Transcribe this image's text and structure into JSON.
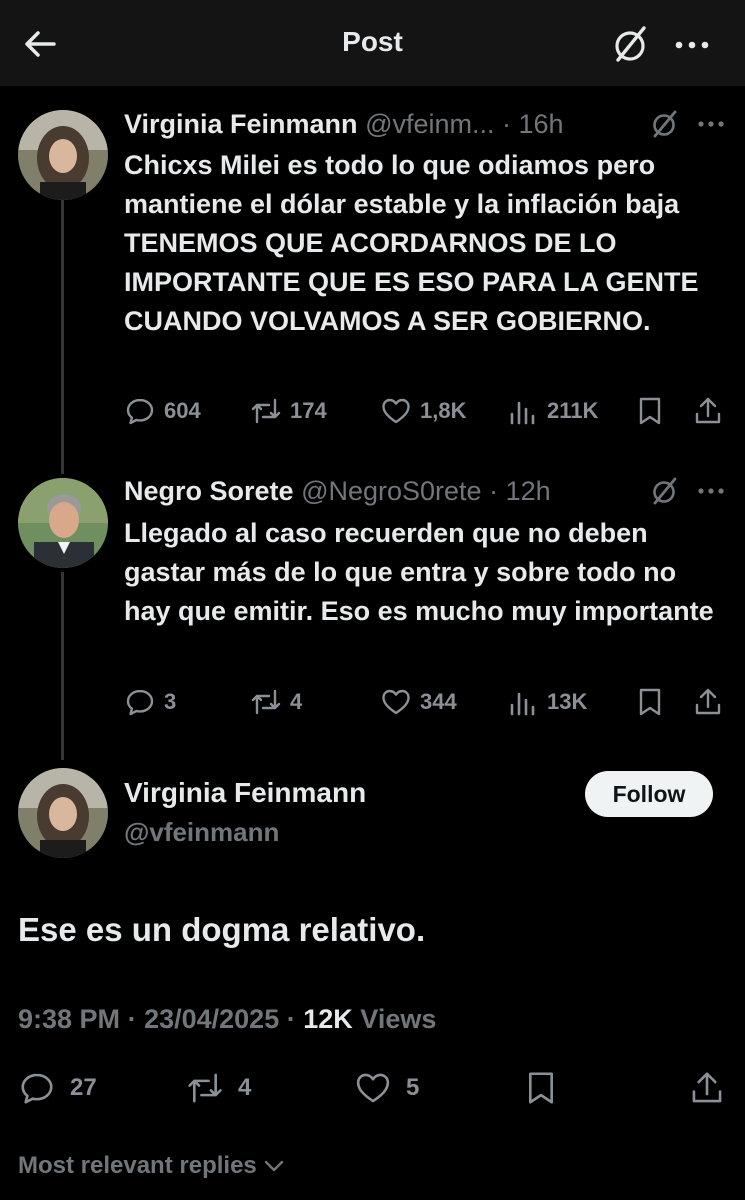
{
  "header": {
    "title": "Post",
    "back_icon": "arrow-left-icon",
    "grok_icon": "grok-icon",
    "more_icon": "more-horizontal-icon"
  },
  "thread": [
    {
      "name": "Virginia Feinmann",
      "handle": "@vfeinm...",
      "time": "16h",
      "text": "Chicxs Milei es todo lo que odiamos pero mantiene el dólar estable y la inflación baja TENEMOS QUE ACORDARNOS DE LO IMPORTANTE QUE ES ESO PARA LA GENTE CUANDO VOLVAMOS A SER GOBIERNO.",
      "replies": "604",
      "reposts": "174",
      "likes": "1,8K",
      "views": "211K"
    },
    {
      "name": "Negro Sorete",
      "handle": "@NegroS0rete",
      "time": "12h",
      "text": "Llegado al caso recuerden que no deben gastar más de lo que entra y sobre todo no hay que emitir. Eso es mucho muy importante",
      "replies": "3",
      "reposts": "4",
      "likes": "344",
      "views": "13K"
    }
  ],
  "main_post": {
    "name": "Virginia Feinmann",
    "handle": "@vfeinmann",
    "follow_label": "Follow",
    "text": "Ese es un dogma relativo.",
    "time": "9:38 PM",
    "date": "23/04/2025",
    "views_count": "12K",
    "views_label": "Views",
    "replies": "27",
    "reposts": "4",
    "likes": "5"
  },
  "replies_sort": {
    "label": "Most relevant replies"
  },
  "colors": {
    "background": "#000000",
    "topbar": "#141414",
    "text": "#e7e9ea",
    "secondary": "#71767b",
    "follow_bg": "#eff3f4"
  }
}
